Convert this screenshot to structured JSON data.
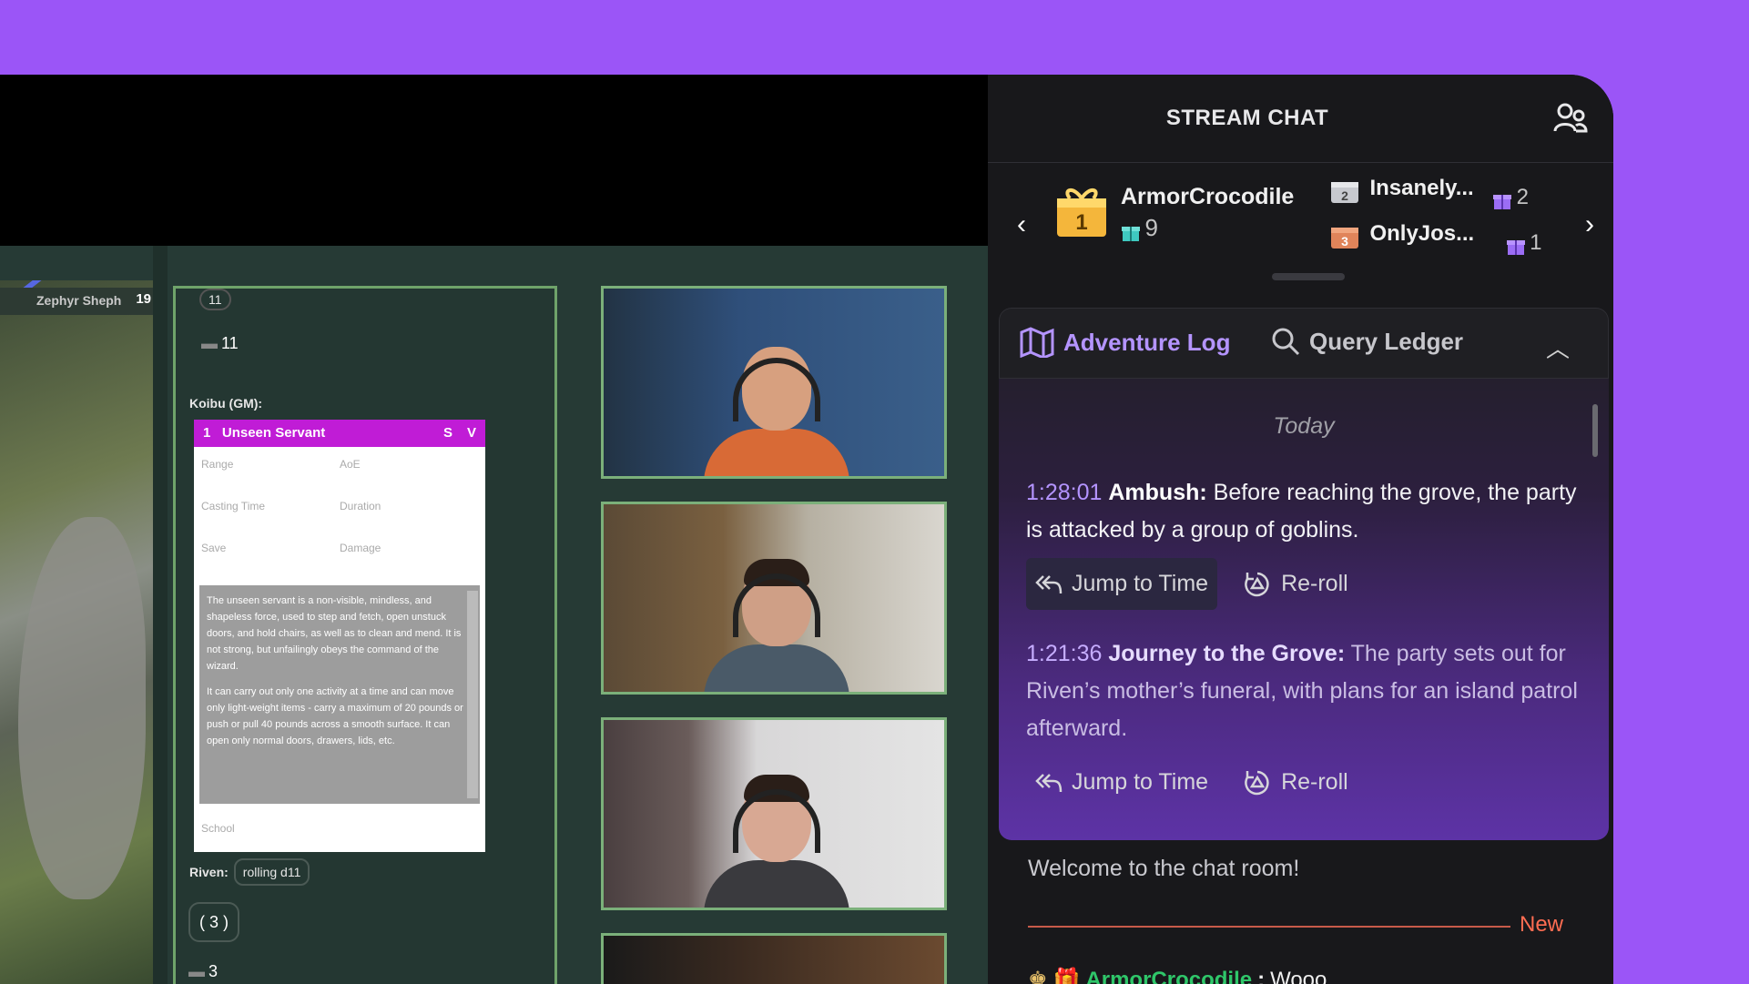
{
  "game": {
    "token_name": "Zephyr Sheph",
    "token_number": "19",
    "roll_top": "11",
    "roll_result": "11",
    "gm_label": "Koibu (GM):",
    "spell": {
      "level": "1",
      "name": "Unseen Servant",
      "tag_s": "S",
      "tag_v": "V",
      "range_label": "Range",
      "aoe_label": "AoE",
      "casting_label": "Casting Time",
      "duration_label": "Duration",
      "save_label": "Save",
      "damage_label": "Damage",
      "desc_1": "The unseen servant is a non-visible, mindless, and shapeless force, used to step and fetch, open unstuck doors, and hold chairs, as well as to clean and mend. It is not strong, but unfailingly obeys the command of the wizard.",
      "desc_2": "It can carry out only one activity at a time and can move only light-weight items - carry a maximum of 20 pounds or push or pull 40 pounds across a smooth surface. It can open only normal doors, drawers, lids, etc.",
      "school_label": "School"
    },
    "riven_label": "Riven:",
    "riven_text": "rolling d11",
    "dice_chip": "( 3 )",
    "last_roll": "3"
  },
  "chat": {
    "title": "STREAM CHAT",
    "leaderboard": {
      "first": {
        "rank": "1",
        "name": "ArmorCrocodile",
        "count": "9"
      },
      "second": {
        "rank": "2",
        "name": "Insanely...",
        "count": "2"
      },
      "third": {
        "rank": "3",
        "name": "OnlyJos...",
        "count": "1"
      }
    },
    "adventure": {
      "tab_log": "Adventure Log",
      "tab_query": "Query Ledger",
      "day": "Today",
      "entries": [
        {
          "time": "1:28:01",
          "title": "Ambush:",
          "text": "Before reaching the grove, the party is attacked by a group of goblins.",
          "jump": "Jump to Time",
          "reroll": "Re-roll"
        },
        {
          "time": "1:21:36",
          "title": "Journey to the Grove:",
          "text": "The party sets out for Riven’s mother’s funeral, with plans for an island patrol afterward.",
          "jump": "Jump to Time",
          "reroll": "Re-roll"
        }
      ]
    },
    "welcome": "Welcome to the chat room!",
    "new_label": "New",
    "message": {
      "user": "ArmorCrocodile",
      "text": "Wooo"
    }
  },
  "colors": {
    "background": "#9b55f7",
    "accent": "#b494ff",
    "spell_header": "#c01cd6",
    "new_marker": "#ff6d52",
    "chat_user": "#2fc76a"
  }
}
